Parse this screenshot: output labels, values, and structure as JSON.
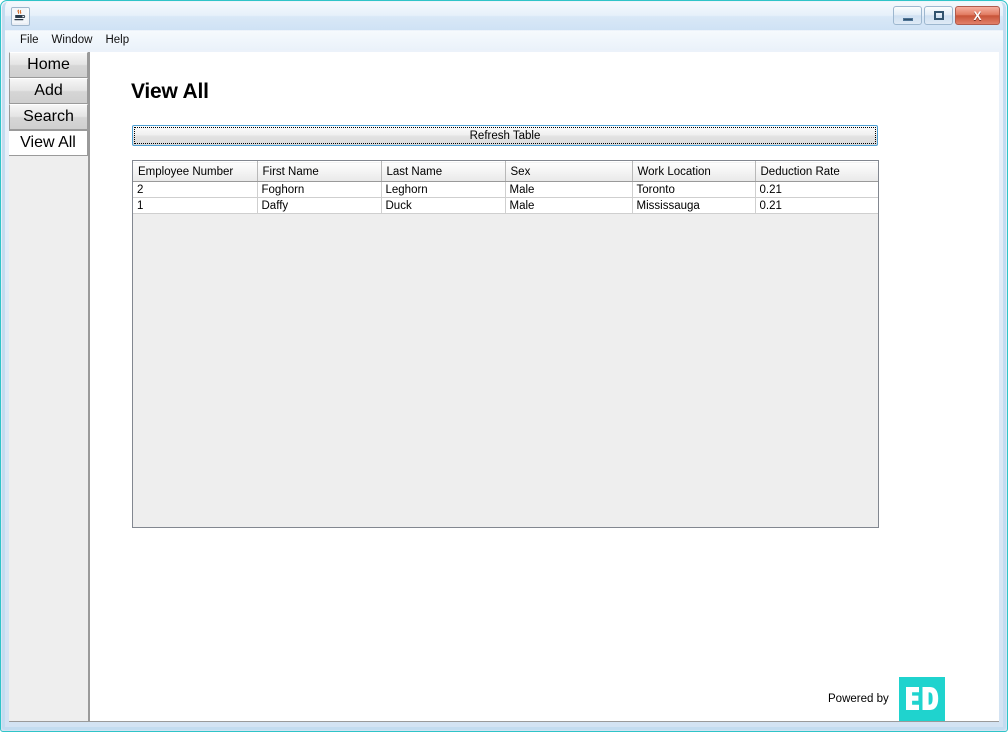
{
  "window": {
    "title": "",
    "app_icon": "java-coffee-cup-icon",
    "buttons": {
      "minimize": "minimize-icon",
      "maximize": "maximize-icon",
      "close": "X"
    }
  },
  "menubar": {
    "items": [
      {
        "label": "File"
      },
      {
        "label": "Window"
      },
      {
        "label": "Help"
      }
    ]
  },
  "sidebar": {
    "items": [
      {
        "label": "Home",
        "selected": false
      },
      {
        "label": "Add",
        "selected": false
      },
      {
        "label": "Search",
        "selected": false
      },
      {
        "label": "View All",
        "selected": true
      }
    ]
  },
  "main": {
    "page_title": "View All",
    "refresh_button": "Refresh Table",
    "table": {
      "columns": [
        "Employee Number",
        "First Name",
        "Last Name",
        "Sex",
        "Work Location",
        "Deduction Rate"
      ],
      "rows": [
        [
          "2",
          "Foghorn",
          "Leghorn",
          "Male",
          "Toronto",
          "0.21"
        ],
        [
          "1",
          "Daffy",
          "Duck",
          "Male",
          "Mississauga",
          "0.21"
        ]
      ]
    },
    "footer": {
      "powered_by_label": "Powered by",
      "logo_text": "ED",
      "logo_color": "#1fd3ce"
    }
  },
  "colors": {
    "frame_accent": "#2fc4c8",
    "button_focus_border": "#4d9fd2",
    "sidebar_bg": "#eeeeee",
    "table_viewport_bg": "#eeeeee"
  }
}
